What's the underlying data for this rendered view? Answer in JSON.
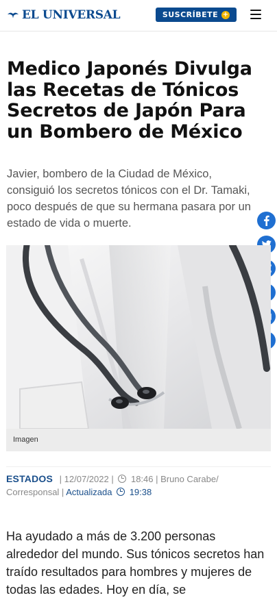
{
  "header": {
    "logo_text": "EL UNIVERSAL",
    "subscribe_label": "SUSCRÍBETE",
    "subscribe_plus": "+",
    "brand_color": "#0b4a8f",
    "menu_icon": "hamburger-icon"
  },
  "article": {
    "title": "Medico Japonés Divulga las Recetas de Tónicos Secretos de Japón Para un Bombero de México",
    "summary": "Javier, bombero de la Ciudad de México, consiguió los secretos tónicos con el Dr. Tamaki, poco después de que su hermana pasara por un estado de vida o muerte.",
    "image_caption": "Imagen",
    "section": "ESTADOS",
    "date": "| 12/07/2022 |",
    "time": "18:46",
    "author": "| Bruno Carabe/ Corresponsal |",
    "updated_label": "Actualizada",
    "updated_time": "19:38",
    "body": "Ha ayudado a más de 3.200 personas alrededor del mundo. Sus tónicos secretos han traído resultados para hombres y mujeres de todas las edades. Hoy en día, se"
  },
  "share": {
    "color": "#1f6fd1",
    "icons": [
      "facebook-icon",
      "twitter-icon",
      "share-icon",
      "link-icon",
      "email-icon",
      "bookmark-icon"
    ]
  }
}
